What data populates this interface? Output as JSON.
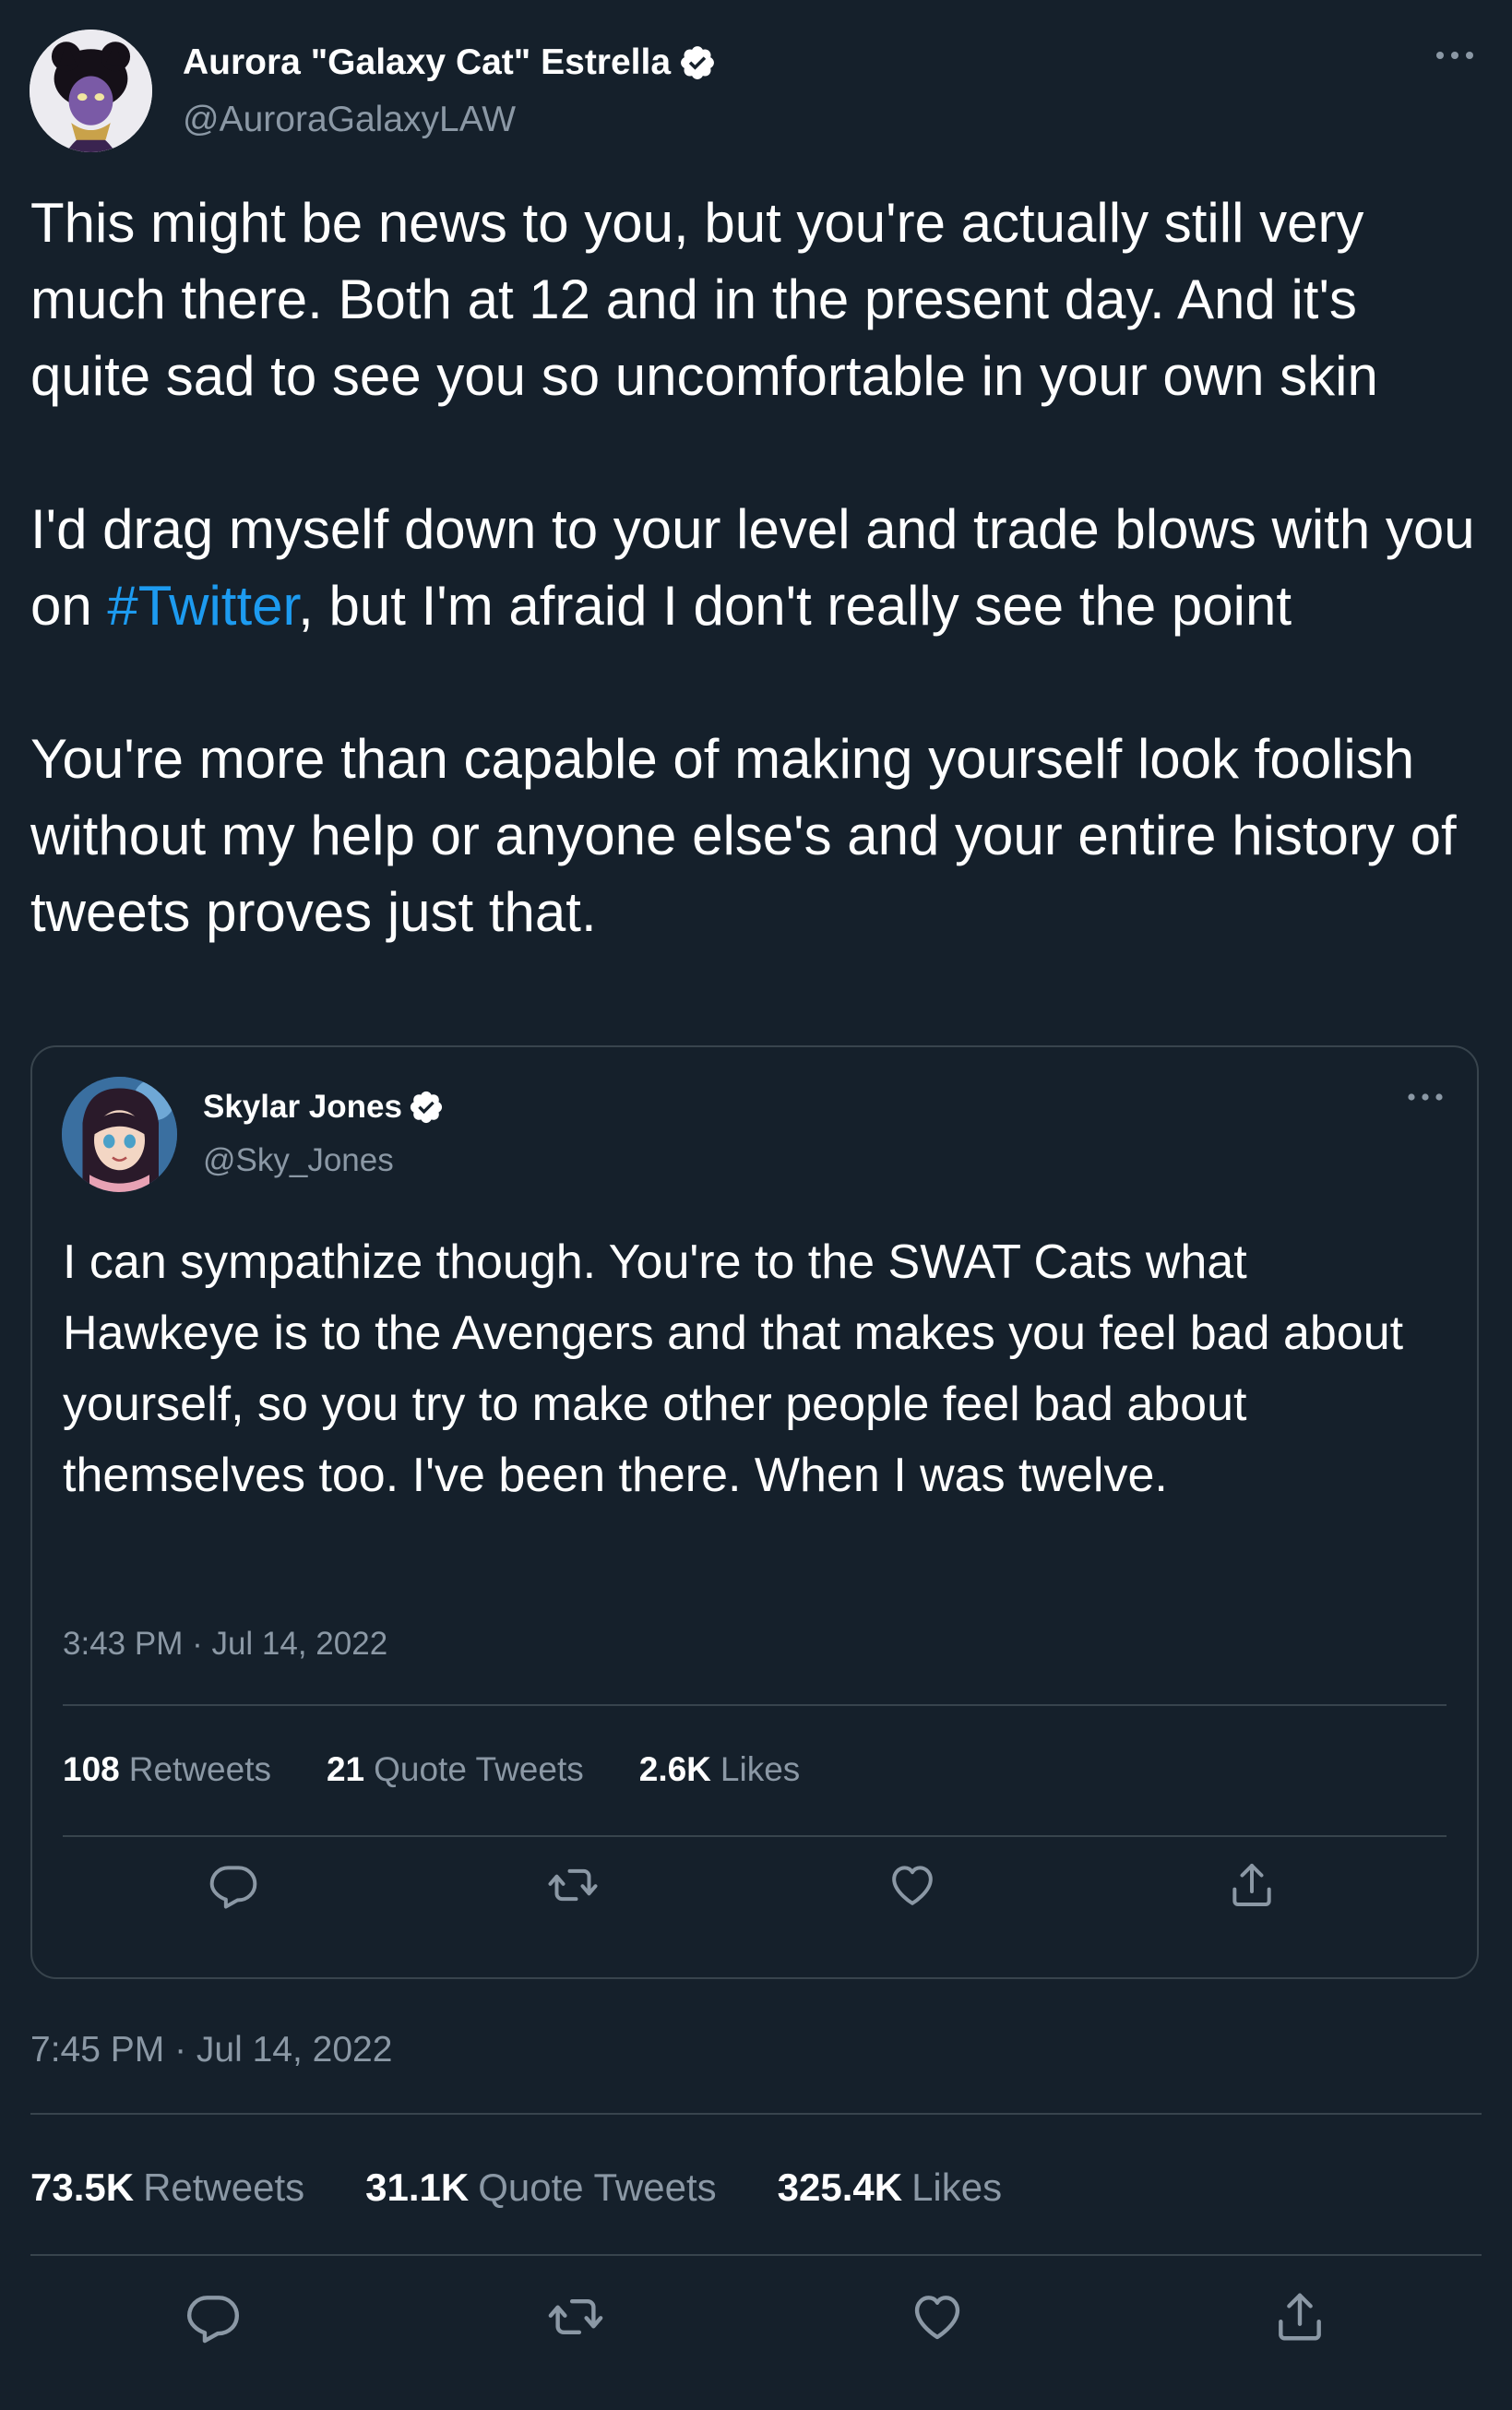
{
  "tweet": {
    "author": {
      "display_name": "Aurora \"Galaxy Cat\" Estrella",
      "handle": "@AuroraGalaxyLAW",
      "verified": true
    },
    "body": {
      "p1": "This might be news to you, but you're actually still very much there. Both at 12 and in the present day. And it's quite sad to see you so uncomfortable in your own skin",
      "p2_before": "I'd drag myself down to your level and trade blows with you on ",
      "p2_hashtag": "#Twitter",
      "p2_after": ", but I'm afraid I don't really see the point",
      "p3": "You're more than capable of making yourself look foolish without my help or anyone else's and your entire history of tweets proves just that."
    },
    "timestamp": "7:45 PM · Jul 14, 2022",
    "stats": {
      "retweets_count": "73.5K",
      "retweets_label": "Retweets",
      "quotes_count": "31.1K",
      "quotes_label": "Quote Tweets",
      "likes_count": "325.4K",
      "likes_label": "Likes"
    }
  },
  "quoted_tweet": {
    "author": {
      "display_name": "Skylar Jones",
      "handle": "@Sky_Jones",
      "verified": true
    },
    "text": "I can sympathize though. You're to the SWAT Cats what Hawkeye is to the Avengers and that makes you feel bad about yourself, so you try to make other people feel bad about themselves too. I've been there. When I was twelve.",
    "timestamp": "3:43 PM · Jul 14, 2022",
    "stats": {
      "retweets_count": "108",
      "retweets_label": "Retweets",
      "quotes_count": "21",
      "quotes_label": "Quote Tweets",
      "likes_count": "2.6K",
      "likes_label": "Likes"
    }
  },
  "icons": {
    "more": "more-horizontal-icon",
    "verified": "verified-badge-icon",
    "reply": "reply-icon",
    "retweet": "retweet-icon",
    "like": "heart-icon",
    "share": "share-icon"
  },
  "colors": {
    "background": "#15202b",
    "text": "#ffffff",
    "secondary_text": "#8b98a5",
    "link": "#1d9bf0",
    "border": "#38444d"
  }
}
